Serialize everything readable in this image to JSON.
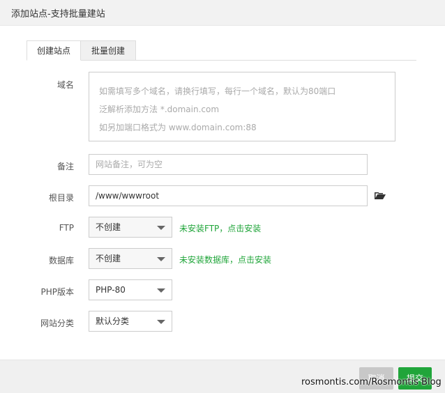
{
  "dialog": {
    "title": "添加站点-支持批量建站"
  },
  "tabs": [
    {
      "label": "创建站点"
    },
    {
      "label": "批量创建"
    }
  ],
  "form": {
    "domain": {
      "label": "域名",
      "placeholder_lines": [
        "如需填写多个域名，请换行填写，每行一个域名，默认为80端口",
        "泛解析添加方法 *.domain.com",
        "如另加端口格式为 www.domain.com:88"
      ]
    },
    "remark": {
      "label": "备注",
      "placeholder": "网站备注，可为空"
    },
    "root": {
      "label": "根目录",
      "value": "/www/wwwroot"
    },
    "ftp": {
      "label": "FTP",
      "selected": "不创建",
      "hint": "未安装FTP，点击安装"
    },
    "database": {
      "label": "数据库",
      "selected": "不创建",
      "hint": "未安装数据库，点击安装"
    },
    "php": {
      "label": "PHP版本",
      "selected": "PHP-80"
    },
    "category": {
      "label": "网站分类",
      "selected": "默认分类"
    }
  },
  "footer": {
    "cancel_label": "取消",
    "submit_label": "提交"
  },
  "watermark": "rosmontis.com/Rosmontis Blog",
  "colors": {
    "accent_green": "#20a53a",
    "folder_icon": "#333333"
  },
  "icons": {
    "folder": "folder-open-icon",
    "select_arrow": "caret-down-icon"
  }
}
